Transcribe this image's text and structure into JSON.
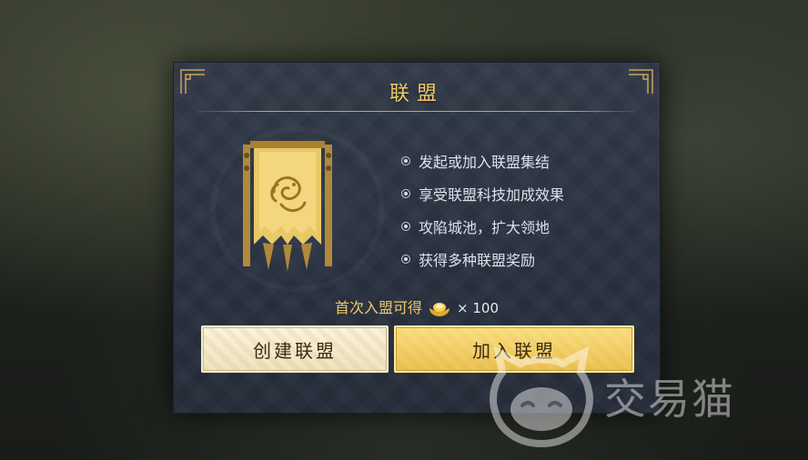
{
  "dialog": {
    "title": "联盟",
    "benefits": [
      "发起或加入联盟集结",
      "享受联盟科技加成效果",
      "攻陷城池，扩大领地",
      "获得多种联盟奖励"
    ],
    "reward": {
      "label": "首次入盟可得",
      "icon": "gold-ingot-icon",
      "quantity": "× 100"
    },
    "buttons": {
      "create_label": "创建联盟",
      "join_label": "加入联盟"
    }
  },
  "watermark": {
    "text": "交易猫",
    "icon": "cat-logo-icon"
  },
  "colors": {
    "accent_gold": "#f0c867",
    "dialog_bg": "#2c3342",
    "create_button": "#f5ead0",
    "join_button": "#f2cc5e"
  }
}
